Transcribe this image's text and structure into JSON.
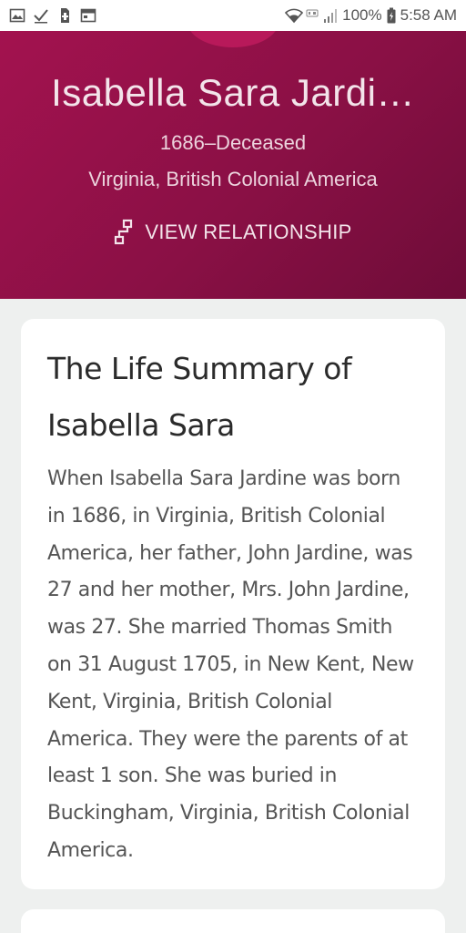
{
  "status_bar": {
    "battery": "100%",
    "time": "5:58 AM",
    "icons": [
      "image-icon",
      "check-icon",
      "sim-icon",
      "calendar-icon",
      "wifi-icon",
      "lte-icon",
      "signal-icon",
      "battery-icon"
    ]
  },
  "person": {
    "name": "Isabella Sara Jardi…",
    "dates": "1686–Deceased",
    "place": "Virginia, British Colonial America",
    "view_relationship_label": "VIEW RELATIONSHIP"
  },
  "life_summary": {
    "title_line1": "The Life Summary of",
    "title_line2": "Isabella Sara",
    "body": "When Isabella Sara Jardine was born in 1686, in Virginia, British Colonial America, her father, John Jardine, was 27 and her mother, Mrs. John Jardine, was 27. She married Thomas Smith on 31 August 1705, in New Kent, New Kent, Virginia, British Colonial America. They were the parents of at least 1 son. She was buried in Buckingham, Virginia, British Colonial America."
  },
  "colors": {
    "hero_bg": "#9a1149",
    "page_bg": "#eef0ef",
    "card_bg": "#ffffff"
  }
}
